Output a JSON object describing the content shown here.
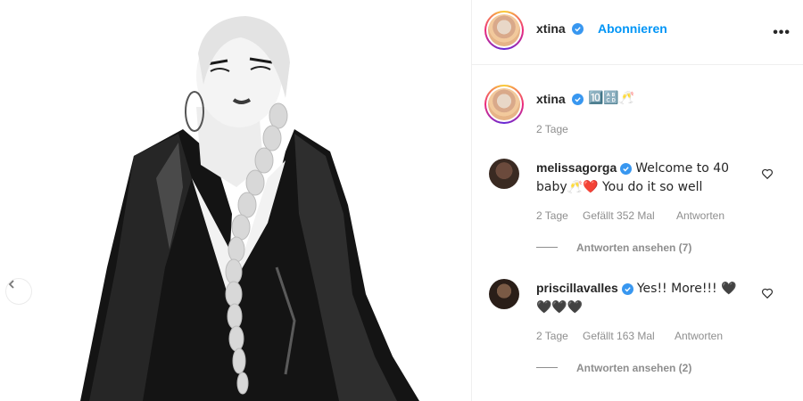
{
  "post": {
    "author": "xtina",
    "follow_label": "Abonnieren",
    "more_label": "•••",
    "caption": "🔟🔠🥂",
    "caption_time": "2 Tage"
  },
  "comments": [
    {
      "username": "melissagorga",
      "text": "Welcome to 40 baby🥂❤️ You do it so well",
      "time": "2 Tage",
      "likes": "Gefällt 352 Mal",
      "reply_label": "Antworten",
      "view_replies": "Antworten ansehen (7)"
    },
    {
      "username": "priscillavalles",
      "text": "Yes!! More!!! 🖤🖤🖤🖤",
      "time": "2 Tage",
      "likes": "Gefällt 163 Mal",
      "reply_label": "Antworten",
      "view_replies": "Antworten ansehen (2)"
    }
  ],
  "colors": {
    "accent": "#0095f6",
    "verified": "#3897f0",
    "muted": "#8e8e8e",
    "heart_red": "#ed4956"
  }
}
